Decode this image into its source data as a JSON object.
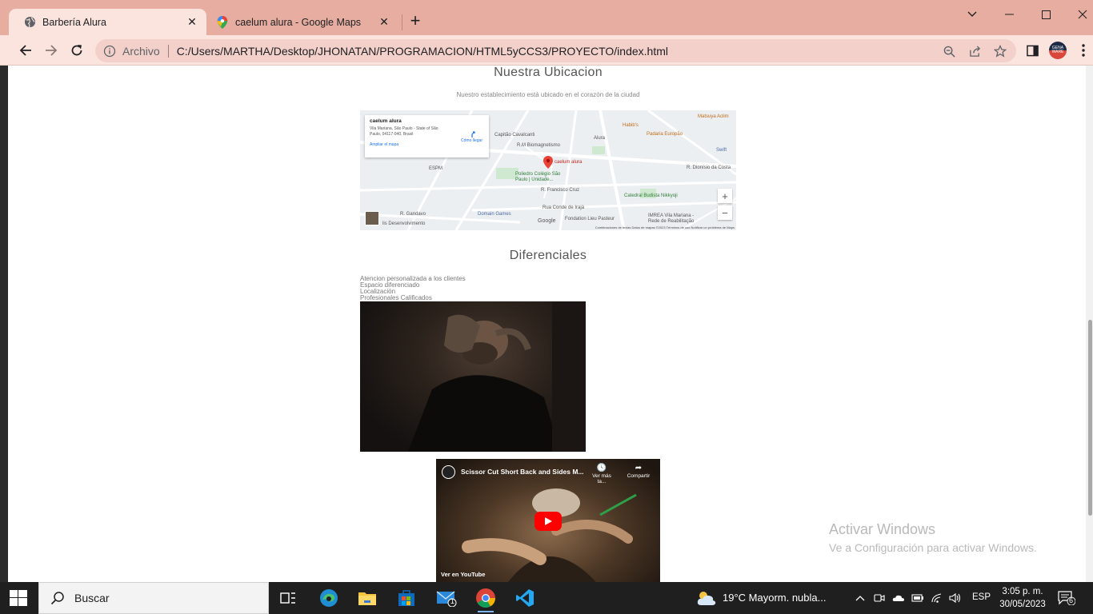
{
  "browser": {
    "tabs": [
      {
        "title": "Barbería Alura",
        "active": true
      },
      {
        "title": "caelum alura - Google Maps",
        "active": false
      }
    ],
    "omnibox": {
      "scheme_label": "Archivo",
      "url": "C:/Users/MARTHA/Desktop/JHONATAN/PROGRAMACION/HTML5yCCS3/PROYECTO/index.html"
    },
    "profile_label": "GENA WARE"
  },
  "page": {
    "location": {
      "title": "Nuestra Ubicacion",
      "subtitle": "Nuestro establecimiento está ubicado en el corazón de la ciudad"
    },
    "map": {
      "place_name": "caelum alura",
      "address": "Vila Mariana, São Paulo - State of São Paulo, 04117-040, Brasil",
      "directions_label": "Cómo llegar",
      "enlarge_label": "Ampliar el mapa",
      "labels": {
        "biomag": "R.M Biomagnetismo",
        "alura": "Alura",
        "pin": "caelum alura",
        "habibs": "Habib's",
        "padaria": "Padaria Europão",
        "matsuya": "Matsuya Aclim",
        "espm": "ESPM",
        "poliedro": "Poliedro Colégio São Paulo | Unidade...",
        "budista": "Catedral Budista Nikkyoji",
        "domain": "Domain Games",
        "pasteur": "Fondation Lieu Pasteur",
        "imrea": "IMREA Vila Mariana - Rede de Reabilitação",
        "conde": "Rua Conde de Irajá",
        "desenv": "lis Desenvolvimento",
        "swift": "Swift",
        "gandavo": "R. Gandavo",
        "cruz": "R. Francisco Cruz",
        "dionisio": "R. Dionísio da Costa",
        "cavalcanti": "Capitão Cavalcanti"
      },
      "google_label": "Google",
      "footer": "Combinaciones de teclas   Datos de mapas ©2023   Términos de uso   Notificar un problema de Maps",
      "zoom_in": "+",
      "zoom_out": "−"
    },
    "differentials": {
      "title": "Diferenciales",
      "items": [
        "Atencion personalizada a los clientes",
        "Espacio diferenciado",
        "Localización",
        "Profesionales Calificados"
      ]
    },
    "video": {
      "title": "Scissor Cut Short Back and Sides M...",
      "watch_later": "Ver más ta...",
      "share": "Compartir",
      "watch_on": "Ver en",
      "youtube": "YouTube"
    }
  },
  "windows_activation": {
    "line1": "Activar Windows",
    "line2": "Ve a Configuración para activar Windows."
  },
  "taskbar": {
    "search_label": "Buscar",
    "weather": "19°C  Mayorm. nubla...",
    "language": "ESP",
    "time": "3:05 p. m.",
    "date": "30/05/2023",
    "mail_badge": "1",
    "notifications": "6"
  },
  "colors": {
    "tabstrip": "#e6ada0",
    "toolbar": "#fbe4de",
    "taskbar": "#1f1f1f",
    "youtube_red": "#ff0000"
  }
}
